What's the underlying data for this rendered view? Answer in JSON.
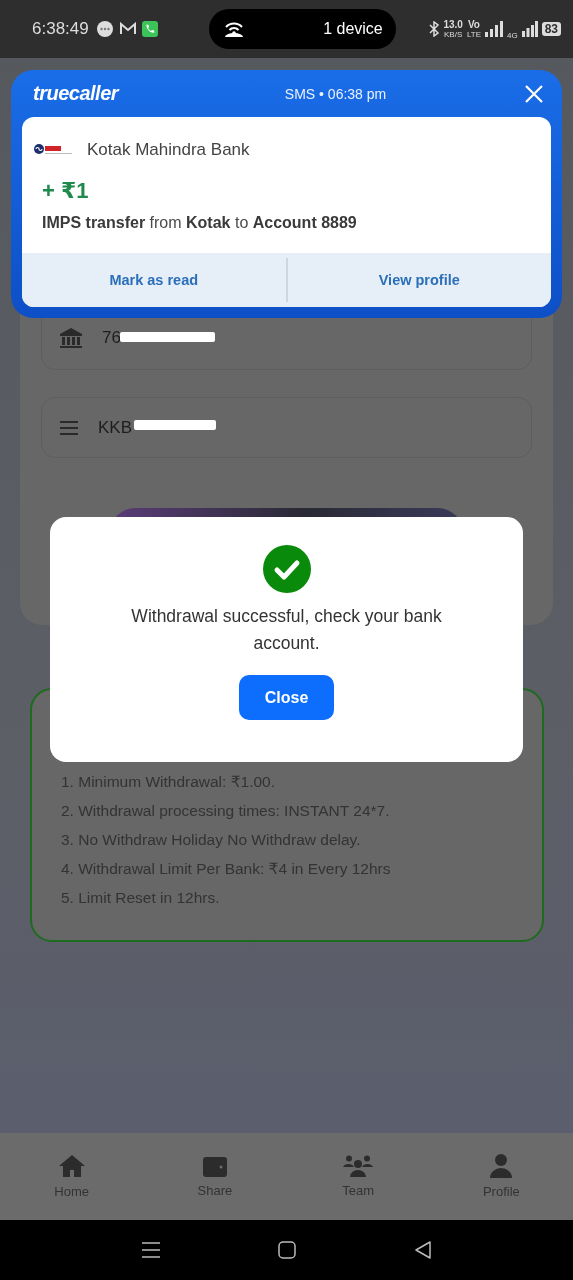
{
  "status_bar": {
    "time": "6:38:49",
    "pill_label": "1 device",
    "speed": "13.0",
    "speed_unit": "KB/S",
    "volte_top": "Vo",
    "volte_bottom": "LTE",
    "network": "4G",
    "battery": "83"
  },
  "notification": {
    "app": "truecaller",
    "meta": "SMS • 06:38 pm",
    "sender": "Kotak Mahindra Bank",
    "amount": "+ ₹1",
    "message": "**IMPS transfer** from **Kotak** to **Account 8889**",
    "actions": [
      "Mark as read",
      "View profile"
    ]
  },
  "form": {
    "fields": [
      {
        "kind": "bank",
        "value": "76"
      },
      {
        "kind": "list",
        "value": "KKB"
      }
    ]
  },
  "rules": [
    "1. Minimum Withdrawal: ₹1.00.",
    "2. Withdrawal processing times: INSTANT 24*7.",
    "3. No Withdraw Holiday No Withdraw delay.",
    "4. Withdrawal Limit Per Bank: ₹4 in Every 12hrs",
    "5. Limit Reset in 12hrs."
  ],
  "dialog": {
    "message": "Withdrawal successful, check your bank account.",
    "button": "Close"
  },
  "nav": [
    {
      "kind": "home",
      "label": "Home"
    },
    {
      "kind": "wallet",
      "label": "Share"
    },
    {
      "kind": "team",
      "label": "Team"
    },
    {
      "kind": "profile",
      "label": "Profile"
    }
  ]
}
